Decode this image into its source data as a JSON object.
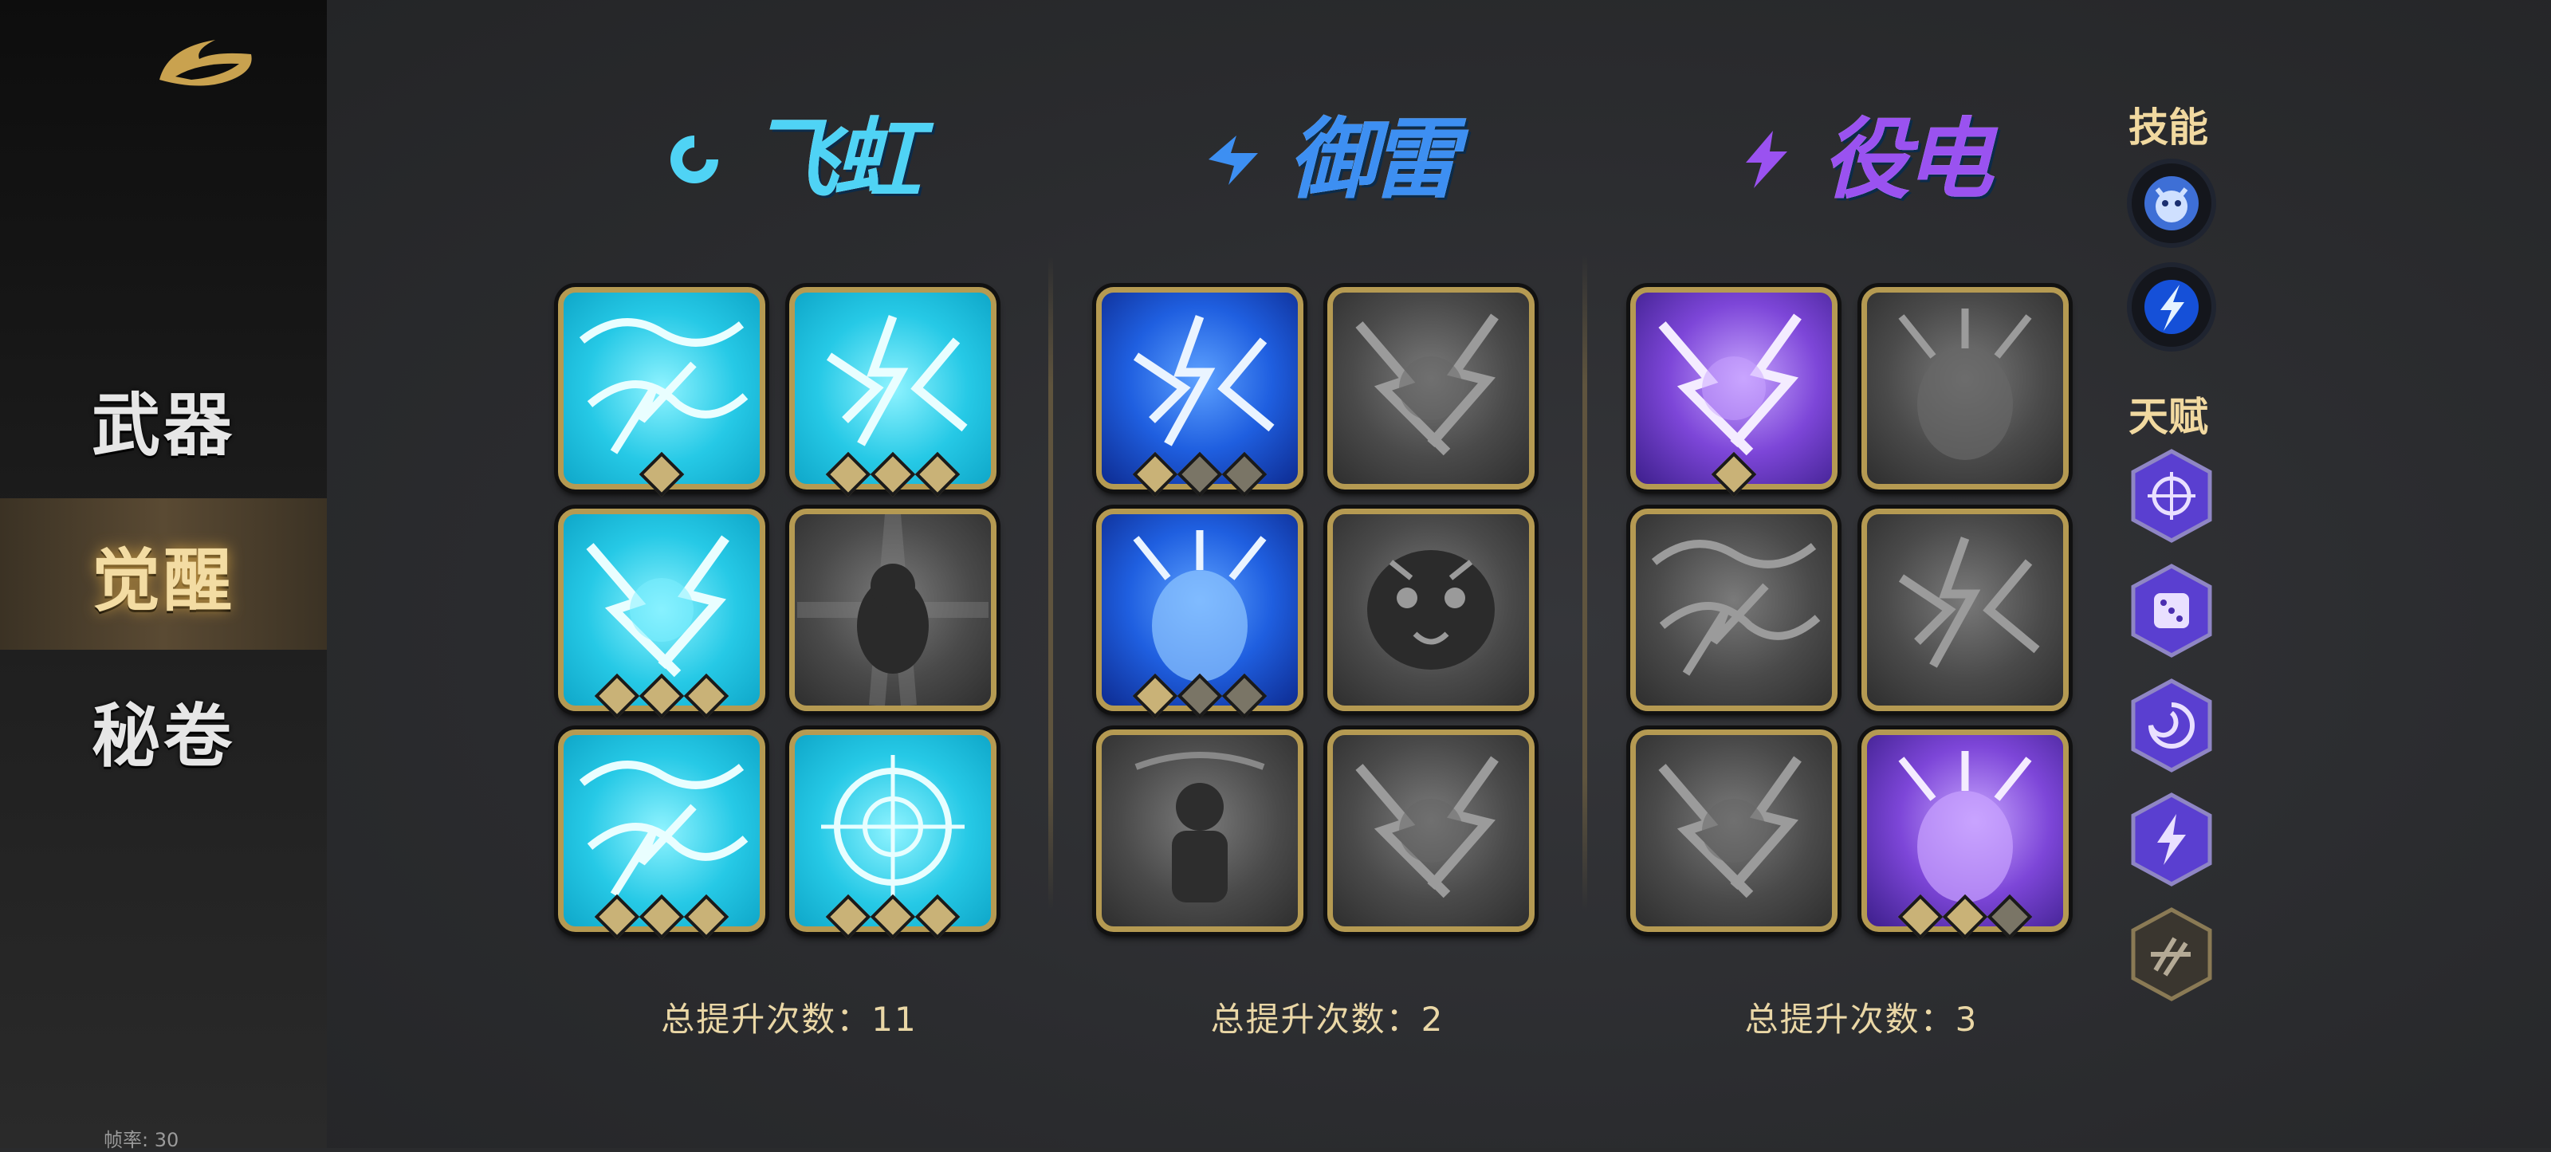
{
  "sidebar": {
    "logo": "dragon-logo-icon",
    "items": [
      {
        "label": "武器",
        "active": false
      },
      {
        "label": "觉醒",
        "active": true
      },
      {
        "label": "秘卷",
        "active": false
      }
    ],
    "fps": "帧率: 30"
  },
  "columns": [
    {
      "title": "飞虹",
      "icon": "swirl-icon",
      "title_color": "#4fd3f5",
      "total_label": "总提升次数：11",
      "cards": [
        {
          "icon": "cyan-lightning-swirl-icon",
          "theme": "cyan",
          "pips": [
            1
          ]
        },
        {
          "icon": "cyan-lightning-burst-icon",
          "theme": "cyan",
          "pips": [
            1,
            1,
            1
          ]
        },
        {
          "icon": "cyan-lightning-storm-icon",
          "theme": "cyan",
          "pips": [
            1,
            1,
            1
          ]
        },
        {
          "icon": "locked-guardian-icon",
          "theme": "gray",
          "pips": []
        },
        {
          "icon": "cyan-bear-spirit-icon",
          "theme": "cyan",
          "pips": [
            1,
            1,
            1
          ]
        },
        {
          "icon": "crosshair-icon",
          "theme": "cyan",
          "pips": [
            1,
            1,
            1
          ]
        }
      ]
    },
    {
      "title": "御雷",
      "icon": "lightning-blade-icon",
      "title_color": "#3d8ff2",
      "total_label": "总提升次数：2",
      "cards": [
        {
          "icon": "blue-thunder-fist-icon",
          "theme": "blue",
          "pips": [
            1,
            0,
            0
          ]
        },
        {
          "icon": "locked-lightning-icon",
          "theme": "gray",
          "pips": []
        },
        {
          "icon": "blue-thunder-wave-icon",
          "theme": "blue",
          "pips": [
            1,
            0,
            0
          ]
        },
        {
          "icon": "tiger-head-icon",
          "theme": "gray",
          "pips": []
        },
        {
          "icon": "locked-warrior-icon",
          "theme": "gray",
          "pips": []
        },
        {
          "icon": "locked-shatter-icon",
          "theme": "gray",
          "pips": []
        }
      ]
    },
    {
      "title": "役电",
      "icon": "bolt-icon",
      "title_color": "#9a52f0",
      "total_label": "总提升次数：3",
      "cards": [
        {
          "icon": "purple-thunder-strike-icon",
          "theme": "purple",
          "pips": [
            1
          ]
        },
        {
          "icon": "locked-storm-cloud-icon",
          "theme": "gray",
          "pips": []
        },
        {
          "icon": "locked-crack-icon",
          "theme": "gray",
          "pips": []
        },
        {
          "icon": "locked-web-icon",
          "theme": "gray",
          "pips": []
        },
        {
          "icon": "locked-zigzag-icon",
          "theme": "gray",
          "pips": []
        },
        {
          "icon": "purple-chain-lightning-icon",
          "theme": "purple",
          "pips": [
            1,
            1,
            0
          ]
        }
      ]
    }
  ],
  "right_panel": {
    "skills_label": "技能",
    "skills": [
      "tiger-spirit-icon",
      "lightning-bolt-icon"
    ],
    "talents_label": "天赋",
    "talents": [
      {
        "icon": "target-icon",
        "active": true
      },
      {
        "icon": "dice-icon",
        "active": true
      },
      {
        "icon": "vortex-icon",
        "active": true
      },
      {
        "icon": "lightning-icon",
        "active": true
      },
      {
        "icon": "claw-burst-icon",
        "active": false
      }
    ]
  }
}
